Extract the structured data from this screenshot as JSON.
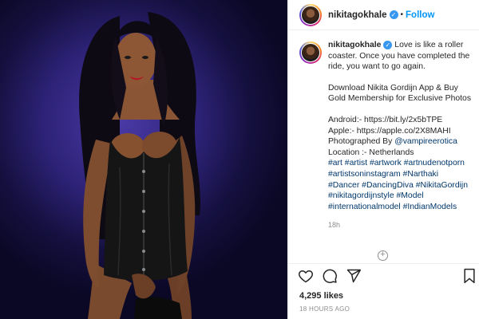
{
  "post": {
    "username": "nikitagokhale",
    "verified_mark": "✓",
    "dot": "•",
    "follow_label": "Follow",
    "caption_intro": "Love is like a roller coaster. Once you have completed the ride, you want to go again.",
    "caption_promo": "Download Nikita Gordijn App & Buy Gold Membership for Exclusive Photos",
    "android_line": "Android:- https://bit.ly/2x5bTPE",
    "apple_line": "Apple:- https://apple.co/2X8MAHI",
    "photographed_prefix": "Photographed By ",
    "photographer_mention": "@vampireerotica",
    "location_line": "Location :- Netherlands",
    "hashtags": "#art #artist #artwork #artnudenotporn #artistsoninstagram #Narthaki #Dancer #DancingDiva #NikitaGordijn #nikitagordijnstyle #Model #internationalmodel #IndianModels",
    "caption_time": "18h",
    "likes": "4,295 likes",
    "posted_ago": "18 HOURS AGO"
  },
  "icons": [
    "heart-icon",
    "comment-icon",
    "share-icon",
    "bookmark-icon",
    "load-more-icon",
    "verified-badge-icon"
  ],
  "colors": {
    "link": "#00376b",
    "follow": "#0095f6",
    "verified": "#3897f0",
    "backdrop": "#2d2277"
  }
}
